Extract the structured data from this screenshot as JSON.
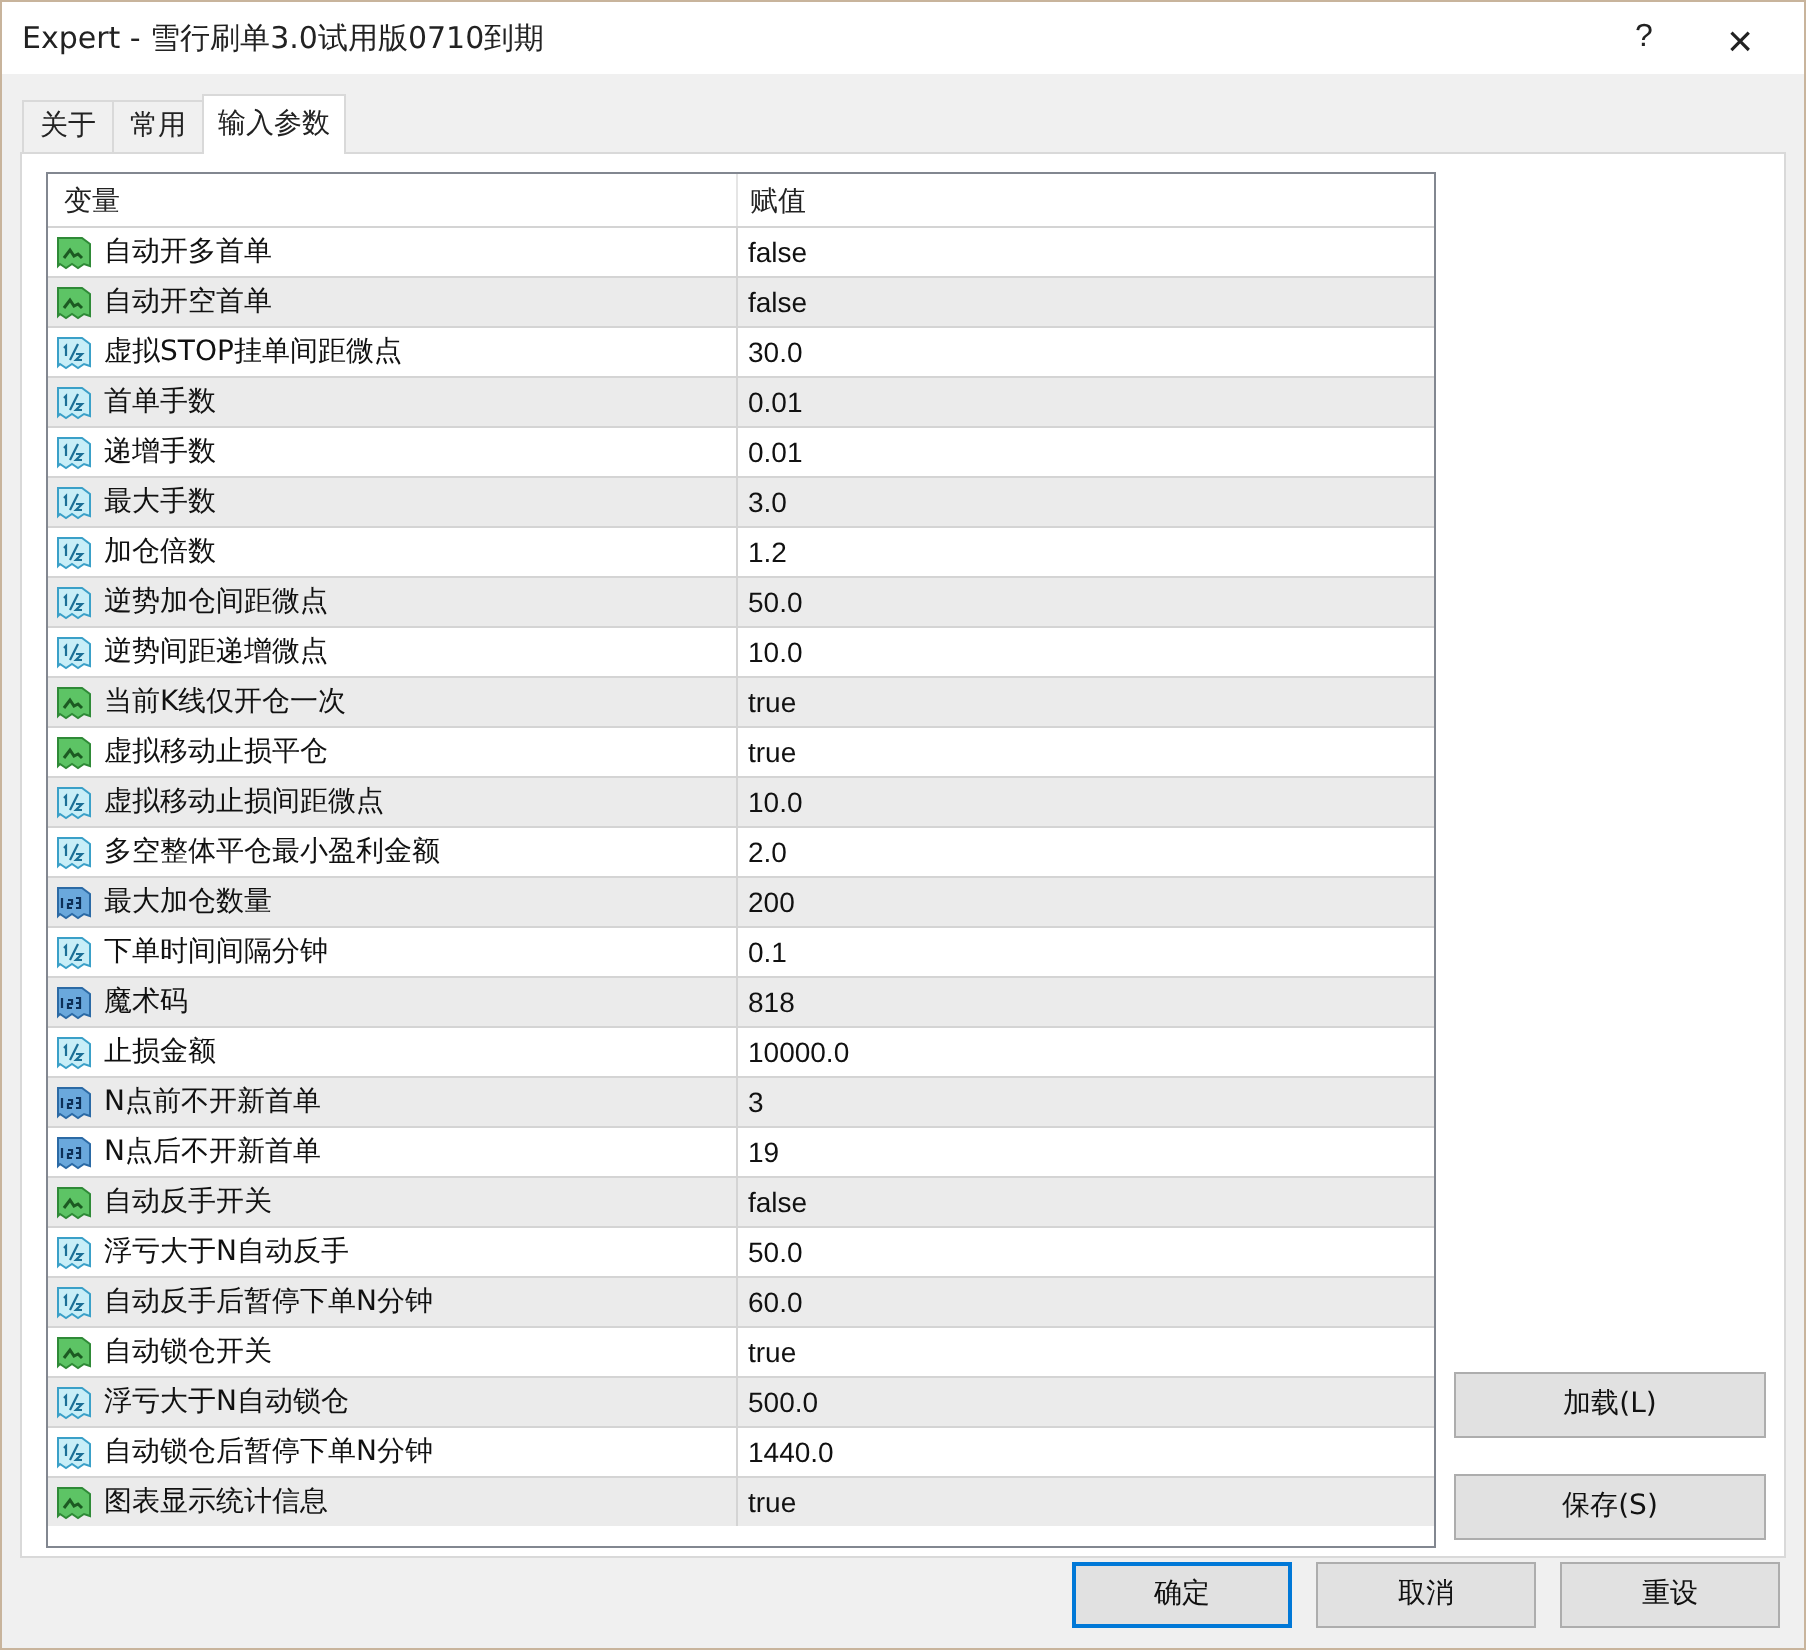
{
  "window": {
    "title": "Expert - 雪行刷单3.0试用版0710到期",
    "help": "?",
    "close": "×"
  },
  "tabs": [
    {
      "label": "关于",
      "selected": false
    },
    {
      "label": "常用",
      "selected": false
    },
    {
      "label": "输入参数",
      "selected": true
    }
  ],
  "table": {
    "columns": [
      "变量",
      "赋值"
    ],
    "rows": [
      {
        "kind": "bool",
        "name": "自动开多首单",
        "value": "false"
      },
      {
        "kind": "bool",
        "name": "自动开空首单",
        "value": "false"
      },
      {
        "kind": "double",
        "name": "虚拟STOP挂单间距微点",
        "value": "30.0"
      },
      {
        "kind": "double",
        "name": "首单手数",
        "value": "0.01"
      },
      {
        "kind": "double",
        "name": "递增手数",
        "value": "0.01"
      },
      {
        "kind": "double",
        "name": "最大手数",
        "value": "3.0"
      },
      {
        "kind": "double",
        "name": "加仓倍数",
        "value": "1.2"
      },
      {
        "kind": "double",
        "name": "逆势加仓间距微点",
        "value": "50.0"
      },
      {
        "kind": "double",
        "name": "逆势间距递增微点",
        "value": "10.0"
      },
      {
        "kind": "bool",
        "name": "当前K线仅开仓一次",
        "value": "true"
      },
      {
        "kind": "bool",
        "name": "虚拟移动止损平仓",
        "value": "true"
      },
      {
        "kind": "double",
        "name": "虚拟移动止损间距微点",
        "value": "10.0"
      },
      {
        "kind": "double",
        "name": "多空整体平仓最小盈利金额",
        "value": "2.0"
      },
      {
        "kind": "int",
        "name": "最大加仓数量",
        "value": "200"
      },
      {
        "kind": "double",
        "name": "下单时间间隔分钟",
        "value": "0.1"
      },
      {
        "kind": "int",
        "name": "魔术码",
        "value": "818"
      },
      {
        "kind": "double",
        "name": "止损金额",
        "value": "10000.0"
      },
      {
        "kind": "int",
        "name": "N点前不开新首单",
        "value": "3"
      },
      {
        "kind": "int",
        "name": "N点后不开新首单",
        "value": "19"
      },
      {
        "kind": "bool",
        "name": "自动反手开关",
        "value": "false"
      },
      {
        "kind": "double",
        "name": "浮亏大于N自动反手",
        "value": "50.0"
      },
      {
        "kind": "double",
        "name": "自动反手后暂停下单N分钟",
        "value": "60.0"
      },
      {
        "kind": "bool",
        "name": "自动锁仓开关",
        "value": "true"
      },
      {
        "kind": "double",
        "name": "浮亏大于N自动锁仓",
        "value": "500.0"
      },
      {
        "kind": "double",
        "name": "自动锁仓后暂停下单N分钟",
        "value": "1440.0"
      },
      {
        "kind": "bool",
        "name": "图表显示统计信息",
        "value": "true"
      }
    ]
  },
  "side_buttons": [
    "加载(L)",
    "保存(S)"
  ],
  "buttons": [
    {
      "label": "确定",
      "default": true
    },
    {
      "label": "取消",
      "default": false
    },
    {
      "label": "重设",
      "default": false
    }
  ]
}
